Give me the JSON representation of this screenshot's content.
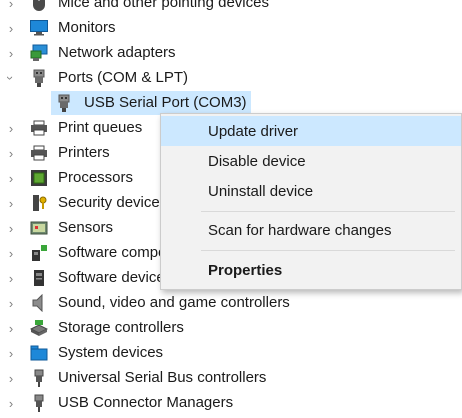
{
  "tree": {
    "items": [
      {
        "label": "Mice and other pointing devices",
        "icon": "mouse-icon",
        "expanded": false
      },
      {
        "label": "Monitors",
        "icon": "monitor-icon",
        "expanded": false
      },
      {
        "label": "Network adapters",
        "icon": "network-adapter-icon",
        "expanded": false
      },
      {
        "label": "Ports (COM & LPT)",
        "icon": "port-icon",
        "expanded": true
      },
      {
        "label": "USB Serial Port (COM3)",
        "icon": "port-icon",
        "child": true,
        "selected": true
      },
      {
        "label": "Print queues",
        "icon": "printer-icon",
        "expanded": false
      },
      {
        "label": "Printers",
        "icon": "printer-icon",
        "expanded": false
      },
      {
        "label": "Processors",
        "icon": "processor-icon",
        "expanded": false
      },
      {
        "label": "Security devices",
        "icon": "security-key-icon",
        "expanded": false
      },
      {
        "label": "Sensors",
        "icon": "sensor-icon",
        "expanded": false
      },
      {
        "label": "Software components",
        "icon": "software-component-icon",
        "expanded": false
      },
      {
        "label": "Software devices",
        "icon": "software-device-icon",
        "expanded": false
      },
      {
        "label": "Sound, video and game controllers",
        "icon": "speaker-icon",
        "expanded": false
      },
      {
        "label": "Storage controllers",
        "icon": "storage-icon",
        "expanded": false
      },
      {
        "label": "System devices",
        "icon": "system-device-icon",
        "expanded": false
      },
      {
        "label": "Universal Serial Bus controllers",
        "icon": "usb-icon",
        "expanded": false
      },
      {
        "label": "USB Connector Managers",
        "icon": "usb-icon",
        "expanded": false
      }
    ]
  },
  "context_menu": {
    "update_driver": "Update driver",
    "disable_device": "Disable device",
    "uninstall_device": "Uninstall device",
    "scan_hardware": "Scan for hardware changes",
    "properties": "Properties",
    "hovered_item": "Update driver"
  },
  "colors": {
    "selection": "#cce8ff",
    "menu_background": "#f2f2f2"
  }
}
